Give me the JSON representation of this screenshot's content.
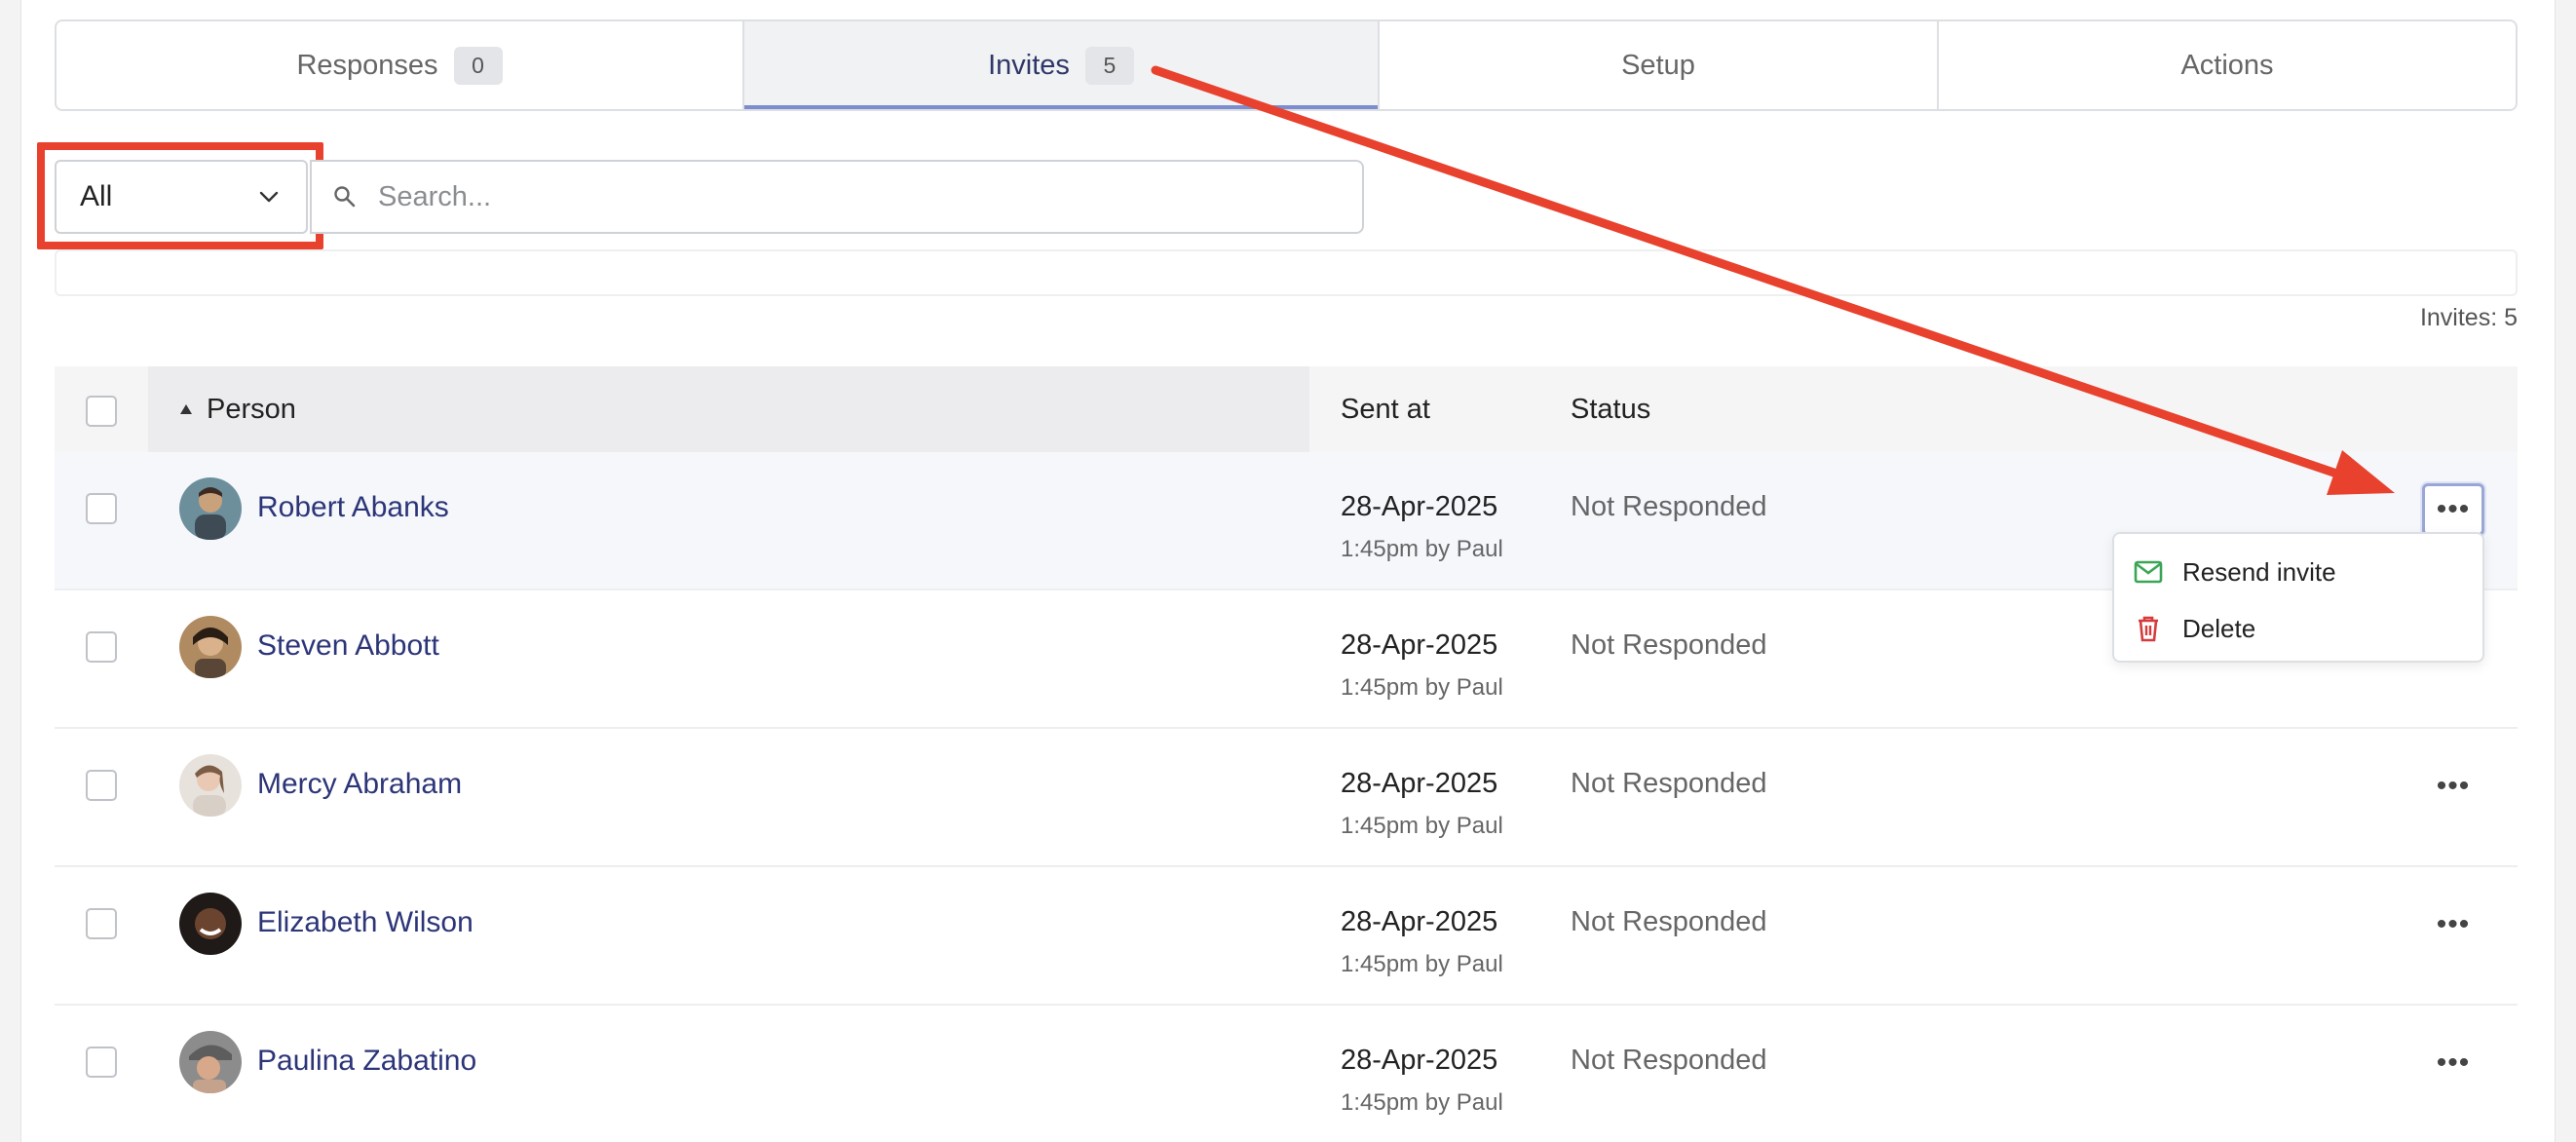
{
  "tabs": [
    {
      "label": "Responses",
      "badge": "0"
    },
    {
      "label": "Invites",
      "badge": "5"
    },
    {
      "label": "Setup"
    },
    {
      "label": "Actions"
    }
  ],
  "filter": {
    "selected": "All"
  },
  "search": {
    "placeholder": "Search..."
  },
  "invite_count": "Invites: 5",
  "table": {
    "headers": {
      "person": "Person",
      "sent_at": "Sent at",
      "status": "Status"
    },
    "rows": [
      {
        "name": "Robert Abanks",
        "date": "28-Apr-2025",
        "by": "1:45pm by Paul",
        "status": "Not Responded"
      },
      {
        "name": "Steven Abbott",
        "date": "28-Apr-2025",
        "by": "1:45pm by Paul",
        "status": "Not Responded"
      },
      {
        "name": "Mercy Abraham",
        "date": "28-Apr-2025",
        "by": "1:45pm by Paul",
        "status": "Not Responded"
      },
      {
        "name": "Elizabeth Wilson",
        "date": "28-Apr-2025",
        "by": "1:45pm by Paul",
        "status": "Not Responded"
      },
      {
        "name": "Paulina Zabatino",
        "date": "28-Apr-2025",
        "by": "1:45pm by Paul",
        "status": "Not Responded"
      }
    ]
  },
  "menu": {
    "items": [
      {
        "label": "Resend invite",
        "icon": "envelope-icon",
        "color": "#3aa655"
      },
      {
        "label": "Delete",
        "icon": "trash-icon",
        "color": "#d63b3b"
      }
    ]
  },
  "colors": {
    "accent": "#7b8ccf",
    "annotation": "#e8422e",
    "link": "#2c3578"
  }
}
